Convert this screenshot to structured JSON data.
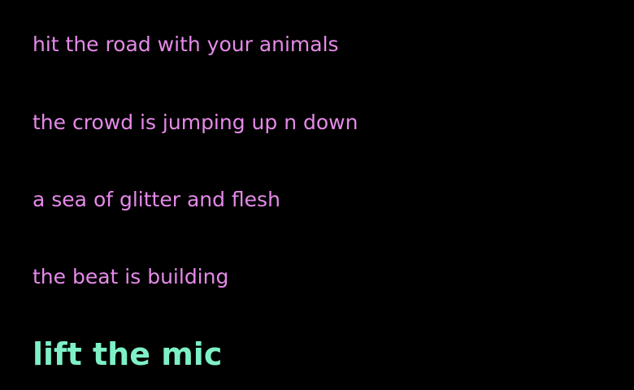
{
  "lines": [
    "hit the road with your animals",
    "the crowd is jumping up n down",
    "a sea of glitter and flesh",
    "the beat is building"
  ],
  "action": "lift the mic",
  "colors": {
    "background": "#000000",
    "lyric": "#e58ae8",
    "action": "#7ff0c6"
  }
}
